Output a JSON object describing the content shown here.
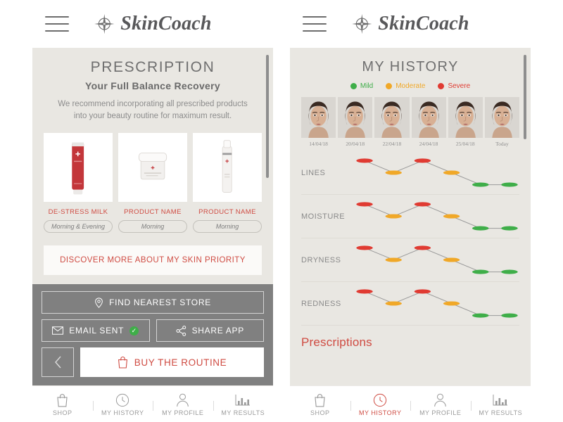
{
  "colors": {
    "background": "#e9e7e2",
    "accent_red": "#cf4b42",
    "gray_band": "#808080",
    "mild_green": "#3fae49",
    "moderate_amber": "#f0a828",
    "severe_red": "#e03b32",
    "text_gray": "#6f6f6f"
  },
  "brand": {
    "name": "SkinCoach",
    "logo_icon": "compass-rose-icon",
    "menu_icon": "hamburger-menu-icon"
  },
  "left_phone": {
    "prescription": {
      "title": "PRESCRIPTION",
      "subtitle": "Your Full Balance Recovery",
      "note": "We recommend incorporating all prescribed products into your beauty routine for maximum result."
    },
    "products": [
      {
        "name": "DE-STRESS MILK",
        "schedule": "Morning & Evening",
        "image": "red-tube-product"
      },
      {
        "name": "PRODUCT NAME",
        "schedule": "Morning",
        "image": "white-jar-product"
      },
      {
        "name": "PRODUCT NAME",
        "schedule": "Morning",
        "image": "white-bottle-product"
      }
    ],
    "discover_label": "DISCOVER MORE ABOUT MY SKIN PRIORITY",
    "actions": {
      "find_store_label": "FIND NEAREST STORE",
      "find_store_icon": "location-pin-icon",
      "email_label": "EMAIL SENT",
      "email_icon": "envelope-icon",
      "email_status_icon": "green-check-icon",
      "share_label": "SHARE APP",
      "share_icon": "share-nodes-icon",
      "back_icon": "chevron-left-icon",
      "buy_label": "BUY THE ROUTINE",
      "buy_icon": "shopping-bag-icon"
    },
    "nav": [
      {
        "label": "SHOP",
        "icon": "shopping-bag-icon",
        "active": false
      },
      {
        "label": "MY HISTORY",
        "icon": "clock-icon",
        "active": false
      },
      {
        "label": "MY PROFILE",
        "icon": "person-icon",
        "active": false
      },
      {
        "label": "MY RESULTS",
        "icon": "bar-chart-icon",
        "active": false
      }
    ]
  },
  "right_phone": {
    "title": "MY HISTORY",
    "legend": [
      {
        "label": "Mild",
        "color": "#3fae49"
      },
      {
        "label": "Moderate",
        "color": "#f0a828"
      },
      {
        "label": "Severe",
        "color": "#e03b32"
      }
    ],
    "timeline": [
      {
        "date": "14/04/18"
      },
      {
        "date": "20/04/18"
      },
      {
        "date": "22/04/18"
      },
      {
        "date": "24/04/18"
      },
      {
        "date": "25/04/18"
      },
      {
        "date": "Today"
      }
    ],
    "prescriptions_label": "Prescriptions",
    "nav": [
      {
        "label": "SHOP",
        "icon": "shopping-bag-icon",
        "active": false
      },
      {
        "label": "MY HISTORY",
        "icon": "clock-icon",
        "active": true
      },
      {
        "label": "MY PROFILE",
        "icon": "person-icon",
        "active": false
      },
      {
        "label": "MY RESULTS",
        "icon": "bar-chart-icon",
        "active": false
      }
    ]
  },
  "chart_data": {
    "type": "line",
    "title": "MY HISTORY",
    "xlabel": "",
    "ylabel": "",
    "grid": false,
    "legend_position": "top",
    "x": [
      "14/04/18",
      "20/04/18",
      "22/04/18",
      "24/04/18",
      "25/04/18",
      "Today"
    ],
    "severity_scale": {
      "severe": 3,
      "moderate": 2,
      "mild": 1
    },
    "level_colors": {
      "severe": "#e03b32",
      "moderate": "#f0a828",
      "mild": "#3fae49"
    },
    "series": [
      {
        "name": "LINES",
        "values": [
          3,
          2,
          3,
          2,
          1,
          1
        ],
        "levels": [
          "severe",
          "moderate",
          "severe",
          "moderate",
          "mild",
          "mild"
        ]
      },
      {
        "name": "MOISTURE",
        "values": [
          3,
          2,
          3,
          2,
          1,
          1
        ],
        "levels": [
          "severe",
          "moderate",
          "severe",
          "moderate",
          "mild",
          "mild"
        ]
      },
      {
        "name": "DRYNESS",
        "values": [
          3,
          2,
          3,
          2,
          1,
          1
        ],
        "levels": [
          "severe",
          "moderate",
          "severe",
          "moderate",
          "mild",
          "mild"
        ]
      },
      {
        "name": "REDNESS",
        "values": [
          3,
          2,
          3,
          2,
          1,
          1
        ],
        "levels": [
          "severe",
          "moderate",
          "severe",
          "moderate",
          "mild",
          "mild"
        ]
      }
    ]
  }
}
